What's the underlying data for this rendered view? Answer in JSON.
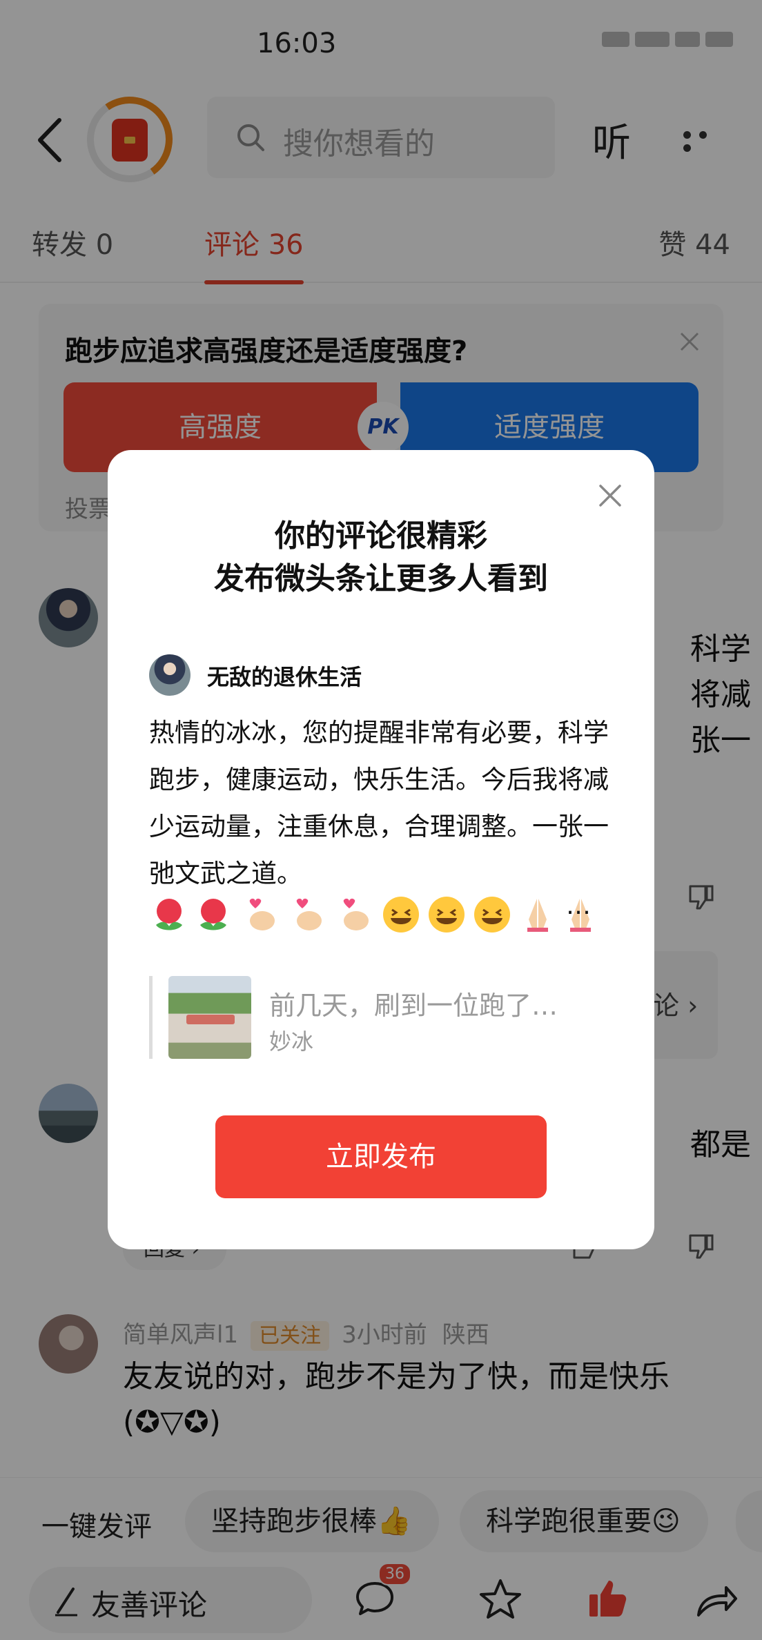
{
  "status_bar": {
    "time": "16:03"
  },
  "header": {
    "search_placeholder": "搜你想看的",
    "listen_label": "听"
  },
  "tabs": {
    "repost": "转发 0",
    "comments": "评论 36",
    "likes": "赞 44"
  },
  "poll": {
    "question": "跑步应追求高强度还是适度强度?",
    "option_a": "高强度",
    "option_b": "适度强度",
    "pk_label": "PK",
    "vote_hint": "投票"
  },
  "comments": {
    "first_partial_lines": [
      "科学",
      "将减",
      "张一"
    ],
    "first_reply_partial": "论 ›",
    "second_partial": "都是",
    "second_reply_label": "回复 ›",
    "third": {
      "user": "简单风声l1",
      "follow_label": "已关注",
      "time": "3小时前",
      "location": "陕西",
      "text_line1": "友友说的对，跑步不是为了快，而是快乐",
      "text_line2": "(✪▽✪)"
    }
  },
  "quick_comments": {
    "label": "一键发评",
    "chip1": "坚持跑步很棒👍",
    "chip2": "科学跑很重要😉"
  },
  "bottom_bar": {
    "input_label": "友善评论",
    "comment_badge": "36"
  },
  "modal": {
    "headline_line1": "你的评论很精彩",
    "headline_line2": "发布微头条让更多人看到",
    "username": "无敌的退休生活",
    "body": "热情的冰冰，您的提醒非常有必要，科学跑步，健康运动，快乐生活。今后我将减少运动量，注重休息，合理调整。一张一弛文武之道。",
    "ellipsis": "…",
    "quote_title": "前几天，刷到一位跑了…",
    "quote_author": "妙冰",
    "publish_label": "立即发布"
  },
  "colors": {
    "accent_red": "#f24135",
    "pk_blue": "#1b78e8",
    "follow_orange": "#e08a2a"
  }
}
